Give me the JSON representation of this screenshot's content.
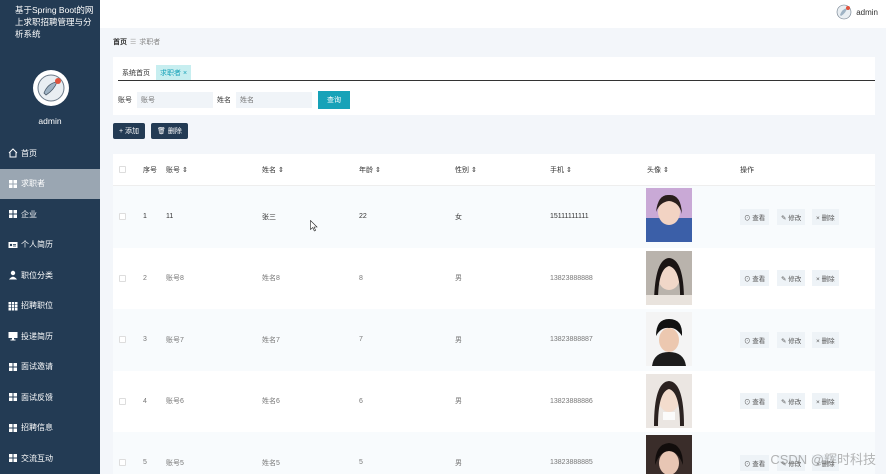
{
  "app_title": "基于Spring Boot的网上求职招聘管理与分析系统",
  "sidebar": {
    "username": "admin",
    "items": [
      {
        "label": "首页",
        "icon": "home-icon",
        "active": false
      },
      {
        "label": "求职者",
        "icon": "grid-icon",
        "active": true
      },
      {
        "label": "企业",
        "icon": "grid-icon",
        "active": false
      },
      {
        "label": "个人简历",
        "icon": "id-card-icon",
        "active": false
      },
      {
        "label": "职位分类",
        "icon": "user-icon",
        "active": false
      },
      {
        "label": "招聘职位",
        "icon": "table-icon",
        "active": false
      },
      {
        "label": "投递简历",
        "icon": "monitor-icon",
        "active": false
      },
      {
        "label": "面试邀请",
        "icon": "grid-icon",
        "active": false
      },
      {
        "label": "面试反馈",
        "icon": "grid-icon",
        "active": false
      },
      {
        "label": "招聘信息",
        "icon": "grid-icon",
        "active": false
      },
      {
        "label": "交流互动",
        "icon": "grid-icon",
        "active": false
      }
    ]
  },
  "topbar": {
    "username": "admin"
  },
  "breadcrumb": {
    "home": "首页",
    "separator": "☰",
    "current": "求职者"
  },
  "tabs": [
    {
      "label": "系统首页"
    },
    {
      "label": "求职者 ×"
    }
  ],
  "search": {
    "account_label": "账号",
    "account_placeholder": "账号",
    "name_label": "姓名",
    "name_placeholder": "姓名",
    "query_button": "查询"
  },
  "actions": {
    "add": "+ 添加",
    "delete": "🗑 删除"
  },
  "table": {
    "headers": [
      "序号",
      "账号 ⇕",
      "姓名 ⇕",
      "年龄 ⇕",
      "性别 ⇕",
      "手机 ⇕",
      "头像 ⇕",
      "操作"
    ],
    "op_view": "⊙ 查看",
    "op_edit": "✎ 修改",
    "op_delete": "× 删除",
    "rows": [
      {
        "no": "1",
        "account": "11",
        "name": "张三",
        "age": "22",
        "gender": "女",
        "phone": "15111111111"
      },
      {
        "no": "2",
        "account": "账号8",
        "name": "姓名8",
        "age": "8",
        "gender": "男",
        "phone": "13823888888"
      },
      {
        "no": "3",
        "account": "账号7",
        "name": "姓名7",
        "age": "7",
        "gender": "男",
        "phone": "13823888887"
      },
      {
        "no": "4",
        "account": "账号6",
        "name": "姓名6",
        "age": "6",
        "gender": "男",
        "phone": "13823888886"
      },
      {
        "no": "5",
        "account": "账号5",
        "name": "姓名5",
        "age": "5",
        "gender": "男",
        "phone": "13823888885"
      }
    ]
  },
  "watermark": "CSDN @辉时科技"
}
